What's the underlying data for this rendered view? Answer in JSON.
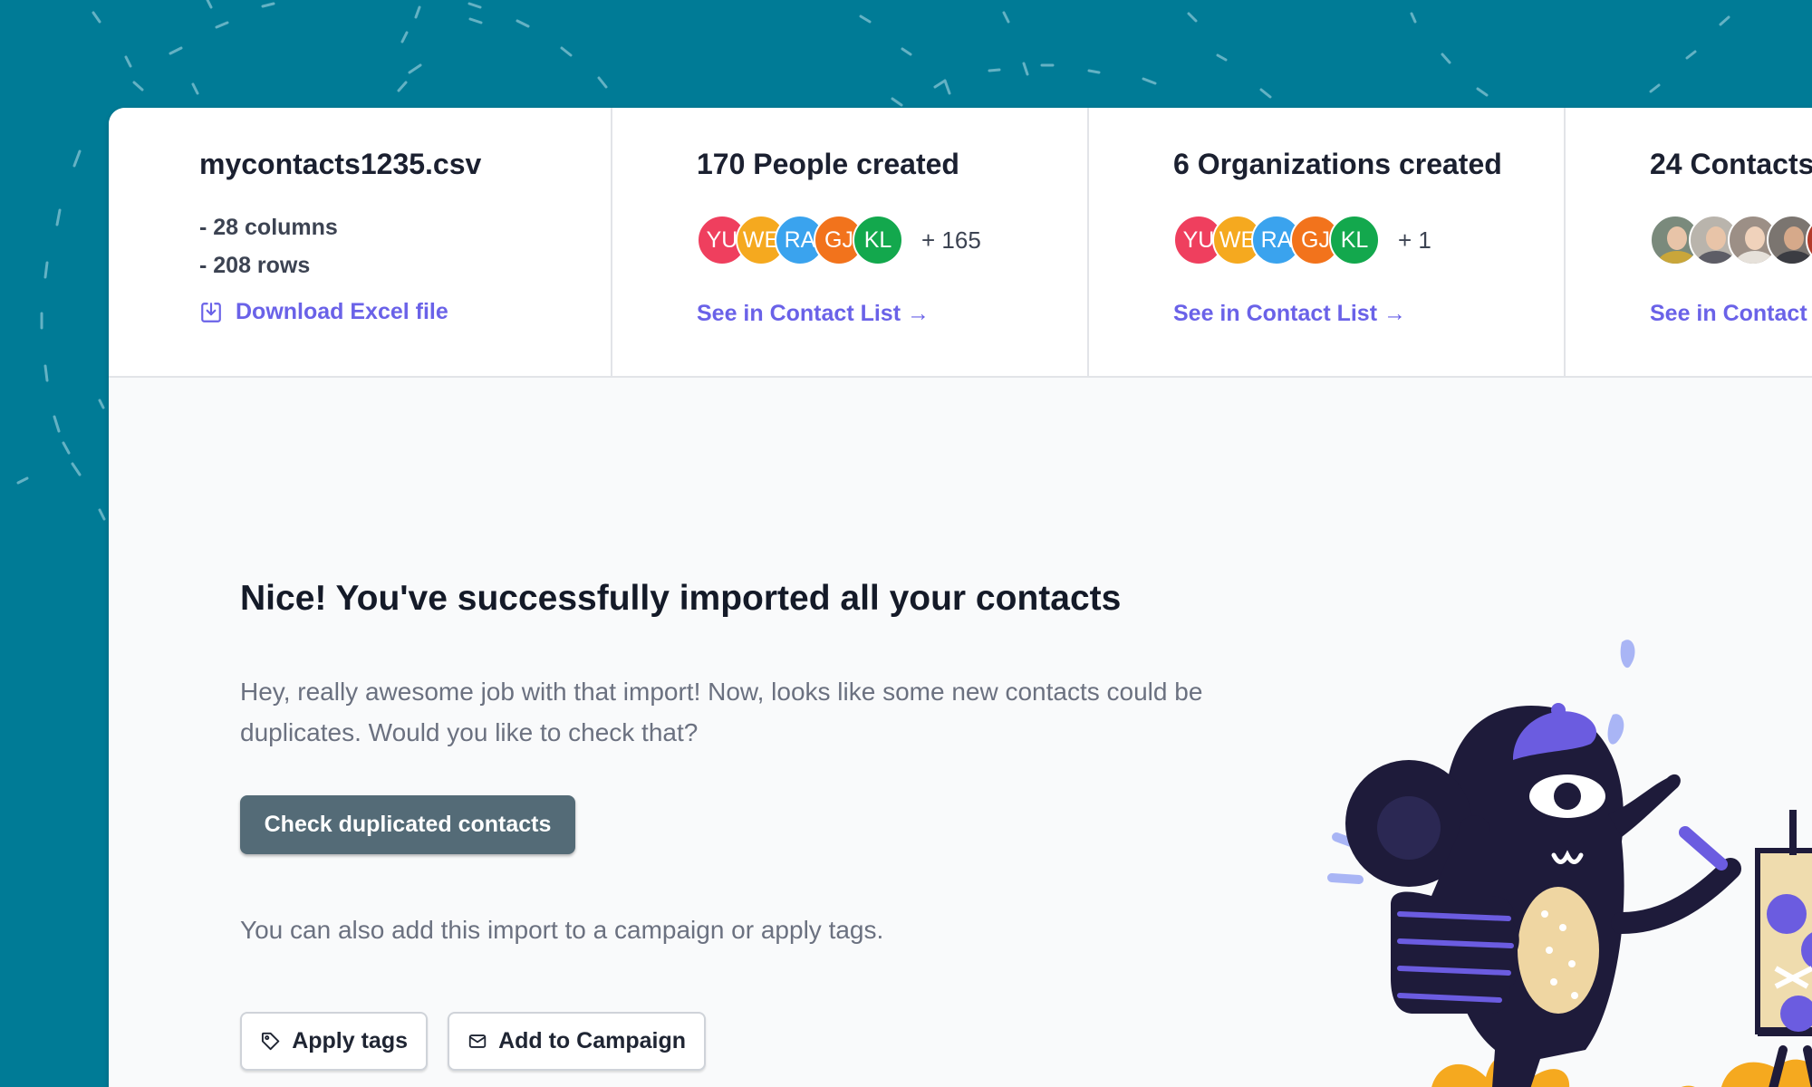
{
  "file": {
    "name": "mycontacts1235.csv",
    "columns": "- 28 columns",
    "rows": "- 208 rows",
    "download_label": "Download Excel file"
  },
  "people": {
    "title": "170 People created",
    "avatars": [
      "YU",
      "WE",
      "RA",
      "GJ",
      "KL"
    ],
    "more": "+ 165",
    "link": "See in Contact List →"
  },
  "organizations": {
    "title": "6 Organizations created",
    "avatars": [
      "YU",
      "WE",
      "RA",
      "GJ",
      "KL"
    ],
    "more": "+ 1",
    "link": "See in Contact List →"
  },
  "contacts": {
    "title": "24 Contacts",
    "link": "See in Contact L"
  },
  "success": {
    "title": "Nice! You've successfully imported all your contacts",
    "body": "Hey, really awesome job with that import! Now, looks like some new contacts could be duplicates. Would you like to check that?",
    "check_button": "Check duplicated contacts",
    "also_text": "You can also add this import to a campaign or apply tags.",
    "apply_tags_button": "Apply tags",
    "add_campaign_button": "Add to Campaign"
  },
  "colors": {
    "background": "#007b96",
    "accent_link": "#6a62e8",
    "primary_button": "#546b77",
    "avatar_red": "#ef3f5e",
    "avatar_yellow": "#f5a91f",
    "avatar_blue": "#3aa3ee",
    "avatar_orange": "#f2731c",
    "avatar_green": "#13a84d"
  },
  "icons": {
    "download": "download-icon",
    "tag": "tag-icon",
    "mail": "mail-icon",
    "arrow": "arrow-right-icon"
  }
}
